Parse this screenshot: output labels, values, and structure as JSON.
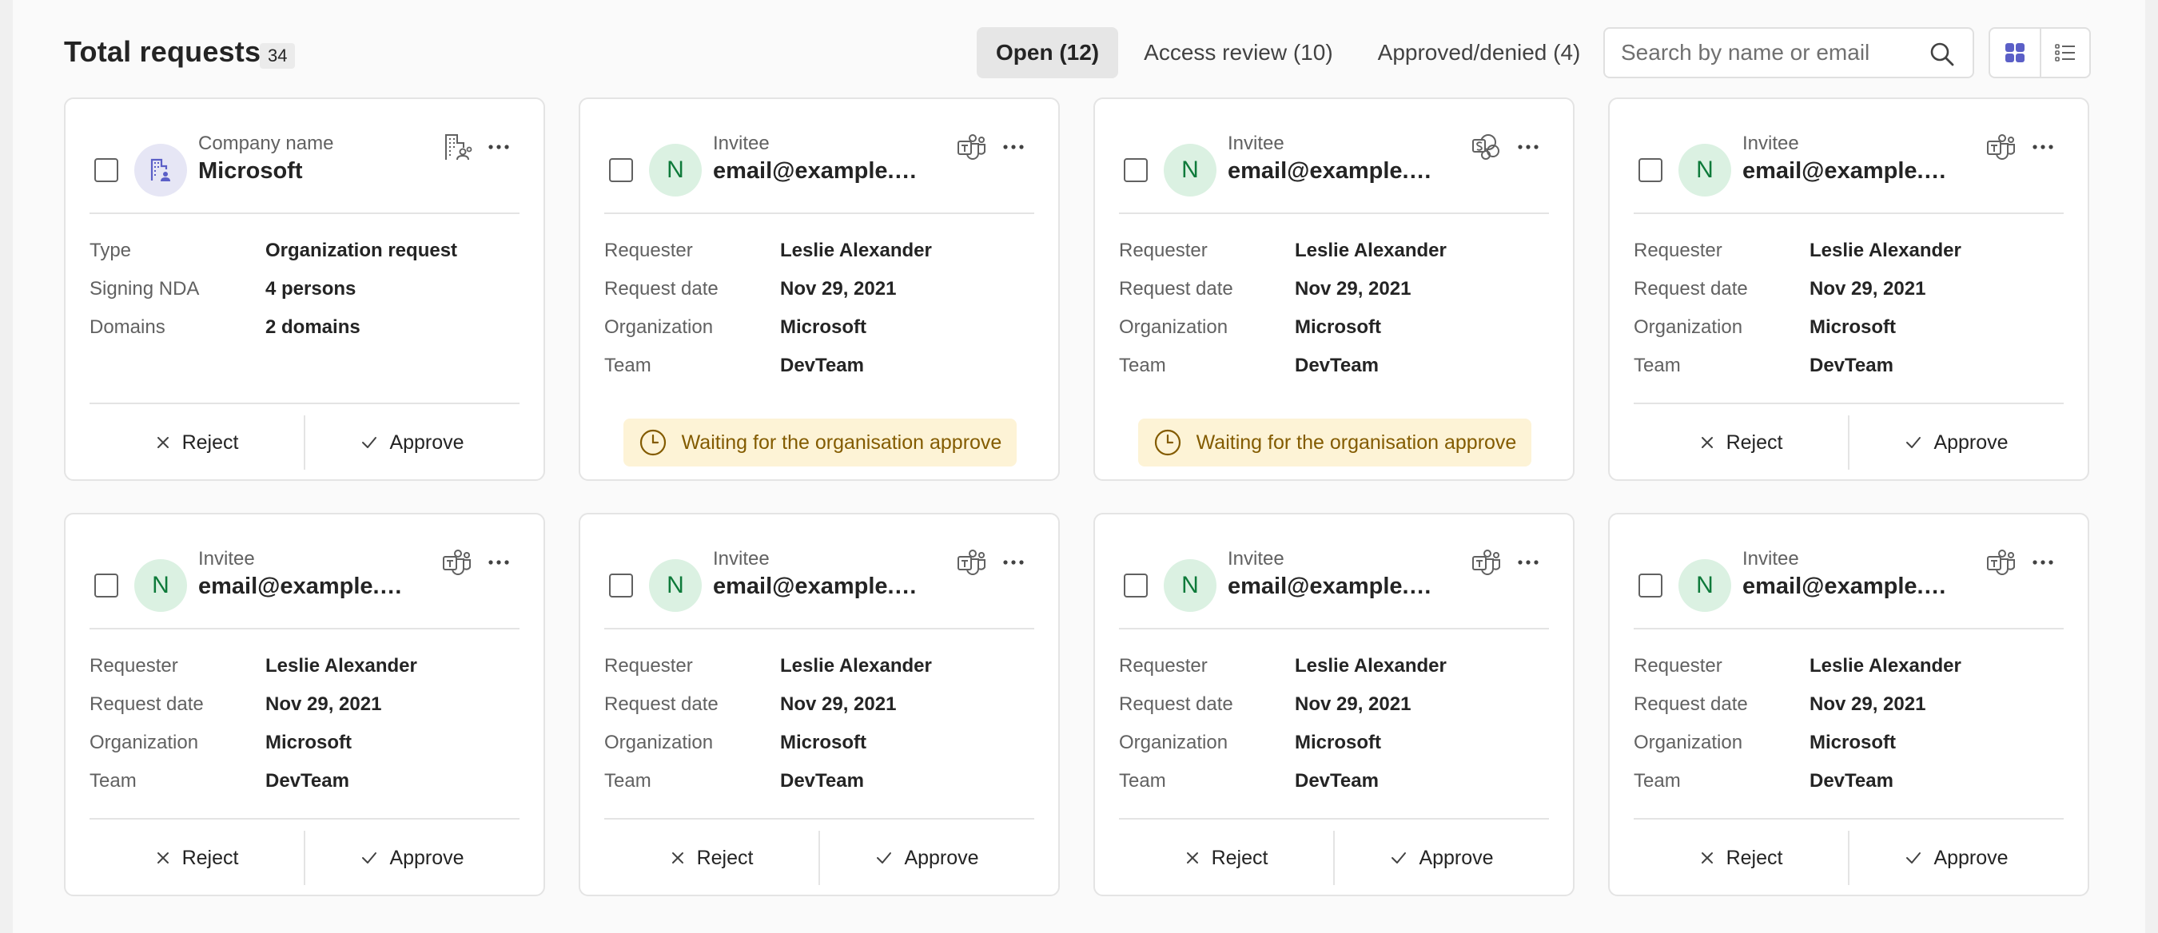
{
  "header": {
    "title": "Total requests",
    "count": "34"
  },
  "tabs": [
    {
      "label": "Open (12)",
      "active": true
    },
    {
      "label": "Access review (10)",
      "active": false
    },
    {
      "label": "Approved/denied (4)",
      "active": false
    }
  ],
  "search": {
    "placeholder": "Search by name or email",
    "value": ""
  },
  "view_toggle": {
    "selected": "grid",
    "options": [
      "grid-view-icon",
      "list-view-icon"
    ]
  },
  "colors": {
    "accent": "#5b5fc7",
    "avatar_bg": "#dbf1e2",
    "avatar_text": "#0e7a3a",
    "waiting_bg": "#fdf3d6",
    "waiting_text": "#835b00"
  },
  "actions": {
    "reject": "Reject",
    "approve": "Approve"
  },
  "cards": [
    {
      "kind": "organization",
      "header_label": "Company name",
      "header_value": "Microsoft",
      "app_icon": "org-request-icon",
      "rows": [
        {
          "k": "Type",
          "v": "Organization request"
        },
        {
          "k": "Signing NDA",
          "v": "4 persons"
        },
        {
          "k": "Domains",
          "v": "2 domains"
        }
      ],
      "footer": "actions"
    },
    {
      "kind": "invitee",
      "avatar": "N",
      "header_label": "Invitee",
      "header_value": "email@example.c...",
      "app_icon": "teams-icon",
      "rows": [
        {
          "k": "Requester",
          "v": "Leslie Alexander"
        },
        {
          "k": "Request date",
          "v": "Nov 29, 2021"
        },
        {
          "k": "Organization",
          "v": "Microsoft"
        },
        {
          "k": "Team",
          "v": "DevTeam"
        }
      ],
      "footer": "waiting",
      "waiting_text": "Waiting for the organisation approve"
    },
    {
      "kind": "invitee",
      "avatar": "N",
      "header_label": "Invitee",
      "header_value": "email@example.c...",
      "app_icon": "sharepoint-icon",
      "rows": [
        {
          "k": "Requester",
          "v": "Leslie Alexander"
        },
        {
          "k": "Request date",
          "v": "Nov 29, 2021"
        },
        {
          "k": "Organization",
          "v": "Microsoft"
        },
        {
          "k": "Team",
          "v": "DevTeam"
        }
      ],
      "footer": "waiting",
      "waiting_text": "Waiting for the organisation approve"
    },
    {
      "kind": "invitee",
      "avatar": "N",
      "header_label": "Invitee",
      "header_value": "email@example.c...",
      "app_icon": "teams-icon",
      "rows": [
        {
          "k": "Requester",
          "v": "Leslie Alexander"
        },
        {
          "k": "Request date",
          "v": "Nov 29, 2021"
        },
        {
          "k": "Organization",
          "v": "Microsoft"
        },
        {
          "k": "Team",
          "v": "DevTeam"
        }
      ],
      "footer": "actions"
    },
    {
      "kind": "invitee",
      "avatar": "N",
      "header_label": "Invitee",
      "header_value": "email@example.c...",
      "app_icon": "teams-icon",
      "rows": [
        {
          "k": "Requester",
          "v": "Leslie Alexander"
        },
        {
          "k": "Request date",
          "v": "Nov 29, 2021"
        },
        {
          "k": "Organization",
          "v": "Microsoft"
        },
        {
          "k": "Team",
          "v": "DevTeam"
        }
      ],
      "footer": "actions"
    },
    {
      "kind": "invitee",
      "avatar": "N",
      "header_label": "Invitee",
      "header_value": "email@example.c...",
      "app_icon": "teams-icon",
      "rows": [
        {
          "k": "Requester",
          "v": "Leslie Alexander"
        },
        {
          "k": "Request date",
          "v": "Nov 29, 2021"
        },
        {
          "k": "Organization",
          "v": "Microsoft"
        },
        {
          "k": "Team",
          "v": "DevTeam"
        }
      ],
      "footer": "actions"
    },
    {
      "kind": "invitee",
      "avatar": "N",
      "header_label": "Invitee",
      "header_value": "email@example.c...",
      "app_icon": "teams-icon",
      "rows": [
        {
          "k": "Requester",
          "v": "Leslie Alexander"
        },
        {
          "k": "Request date",
          "v": "Nov 29, 2021"
        },
        {
          "k": "Organization",
          "v": "Microsoft"
        },
        {
          "k": "Team",
          "v": "DevTeam"
        }
      ],
      "footer": "actions"
    },
    {
      "kind": "invitee",
      "avatar": "N",
      "header_label": "Invitee",
      "header_value": "email@example.c...",
      "app_icon": "teams-icon",
      "rows": [
        {
          "k": "Requester",
          "v": "Leslie Alexander"
        },
        {
          "k": "Request date",
          "v": "Nov 29, 2021"
        },
        {
          "k": "Organization",
          "v": "Microsoft"
        },
        {
          "k": "Team",
          "v": "DevTeam"
        }
      ],
      "footer": "actions"
    }
  ]
}
